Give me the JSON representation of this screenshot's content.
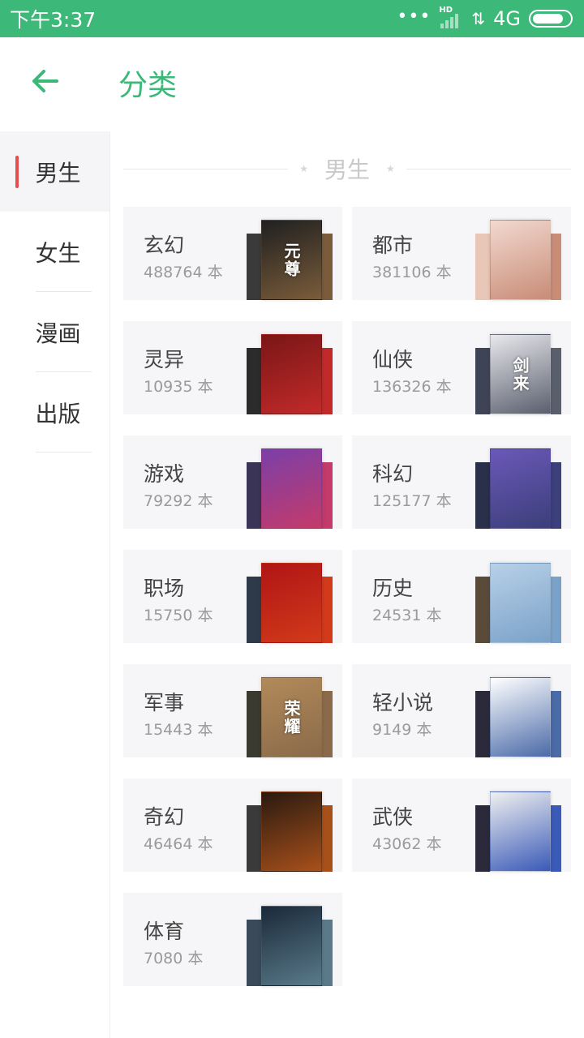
{
  "status": {
    "time": "下午3:37",
    "hd": "HD",
    "network": "4G",
    "battery_level": 0.85
  },
  "header": {
    "title": "分类"
  },
  "sidebar": {
    "items": [
      {
        "label": "男生",
        "active": true
      },
      {
        "label": "女生",
        "active": false
      },
      {
        "label": "漫画",
        "active": false
      },
      {
        "label": "出版",
        "active": false
      }
    ]
  },
  "section": {
    "title": "男生"
  },
  "unit": "本",
  "categories": [
    {
      "name": "玄幻",
      "count": "488764 本",
      "cover_colors": [
        "#3a3a3a",
        "#202020",
        "#7a5c3a"
      ],
      "cover_text": "元尊"
    },
    {
      "name": "都市",
      "count": "381106 本",
      "cover_colors": [
        "#e9c7b8",
        "#f1d9cf",
        "#c98c77"
      ],
      "cover_text": ""
    },
    {
      "name": "灵异",
      "count": "10935 本",
      "cover_colors": [
        "#2b2b2b",
        "#7a1616",
        "#c22a2a"
      ],
      "cover_text": ""
    },
    {
      "name": "仙侠",
      "count": "136326 本",
      "cover_colors": [
        "#3e4456",
        "#e8e8ec",
        "#5a5f6e"
      ],
      "cover_text": "剑来"
    },
    {
      "name": "游戏",
      "count": "79292 本",
      "cover_colors": [
        "#3a3456",
        "#7b3fa8",
        "#c43a6a"
      ],
      "cover_text": ""
    },
    {
      "name": "科幻",
      "count": "125177 本",
      "cover_colors": [
        "#2a2f4a",
        "#6b58b8",
        "#3b3f7a"
      ],
      "cover_text": ""
    },
    {
      "name": "职场",
      "count": "15750 本",
      "cover_colors": [
        "#2e3a4a",
        "#b01515",
        "#d23a1a"
      ],
      "cover_text": ""
    },
    {
      "name": "历史",
      "count": "24531 本",
      "cover_colors": [
        "#5a4a3a",
        "#b8d0e8",
        "#7aa2c8"
      ],
      "cover_text": ""
    },
    {
      "name": "军事",
      "count": "15443 本",
      "cover_colors": [
        "#3a3a30",
        "#b28a5a",
        "#8a6a4a"
      ],
      "cover_text": "荣耀"
    },
    {
      "name": "轻小说",
      "count": "9149 本",
      "cover_colors": [
        "#2a2a3a",
        "#ffffff",
        "#4a6aa8"
      ],
      "cover_text": ""
    },
    {
      "name": "奇幻",
      "count": "46464 本",
      "cover_colors": [
        "#3a3a3a",
        "#2a1a10",
        "#a8501a"
      ],
      "cover_text": ""
    },
    {
      "name": "武侠",
      "count": "43062 本",
      "cover_colors": [
        "#2a2a3a",
        "#f0f0f0",
        "#3a5ab8"
      ],
      "cover_text": ""
    },
    {
      "name": "体育",
      "count": "7080 本",
      "cover_colors": [
        "#3a4a5a",
        "#1a2a3a",
        "#5a7a8a"
      ],
      "cover_text": ""
    }
  ],
  "colors": {
    "accent": "#3cb878",
    "active_marker": "#e84c4c"
  }
}
